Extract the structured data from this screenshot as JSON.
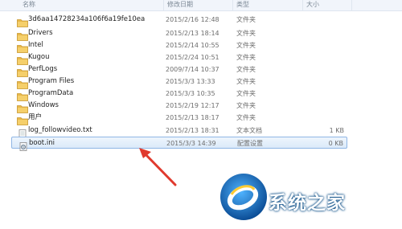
{
  "header": {
    "name_label": "名称",
    "date_label": "修改日期",
    "type_label": "类型",
    "size_label": "大小"
  },
  "files": [
    {
      "name": "3d6aa14728234a106f6a19fe10ea",
      "date": "2015/2/16 12:48",
      "type": "文件夹",
      "size": "",
      "icon": "folder-icon"
    },
    {
      "name": "Drivers",
      "date": "2015/2/13 18:14",
      "type": "文件夹",
      "size": "",
      "icon": "folder-icon"
    },
    {
      "name": "Intel",
      "date": "2015/2/14 10:55",
      "type": "文件夹",
      "size": "",
      "icon": "folder-icon"
    },
    {
      "name": "Kugou",
      "date": "2015/2/24 10:51",
      "type": "文件夹",
      "size": "",
      "icon": "folder-icon"
    },
    {
      "name": "PerfLogs",
      "date": "2009/7/14 10:37",
      "type": "文件夹",
      "size": "",
      "icon": "folder-icon"
    },
    {
      "name": "Program Files",
      "date": "2015/3/3 13:33",
      "type": "文件夹",
      "size": "",
      "icon": "folder-icon"
    },
    {
      "name": "ProgramData",
      "date": "2015/3/3 10:35",
      "type": "文件夹",
      "size": "",
      "icon": "folder-icon"
    },
    {
      "name": "Windows",
      "date": "2015/2/19 12:17",
      "type": "文件夹",
      "size": "",
      "icon": "folder-icon"
    },
    {
      "name": "用户",
      "date": "2015/2/13 18:17",
      "type": "文件夹",
      "size": "",
      "icon": "folder-icon"
    },
    {
      "name": "log_followvideo.txt",
      "date": "2015/2/13 18:31",
      "type": "文本文档",
      "size": "1 KB",
      "icon": "text-file-icon"
    },
    {
      "name": "boot.ini",
      "date": "2015/3/3 14:39",
      "type": "配置设置",
      "size": "0 KB",
      "icon": "settings-file-icon",
      "selected": true
    }
  ],
  "watermark": {
    "text": "系统之家"
  },
  "colors": {
    "folder": "#e8b84a",
    "selection_border": "#8fb6e5",
    "arrow": "#e03a2e",
    "logo_blue": "#1565b0"
  }
}
